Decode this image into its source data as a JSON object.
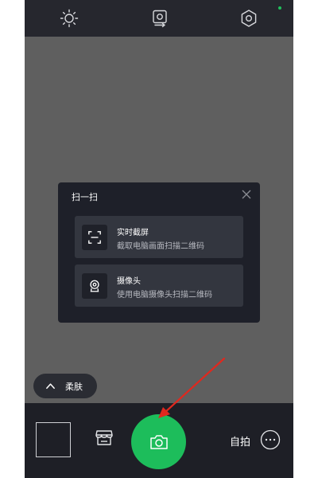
{
  "colors": {
    "topbar_bg": "#26272e",
    "preview_bg": "#5f5f5f",
    "dialog_bg": "#1e2029",
    "option_bg": "#33363f",
    "accent_green": "#1dbd5b",
    "status_dot": "#20c05c",
    "annotation_arrow": "#e0281e"
  },
  "topbar": {
    "icons": [
      "brightness-icon",
      "camera-switch-icon",
      "settings-icon"
    ]
  },
  "scan_dialog": {
    "title": "扫一扫",
    "options": [
      {
        "icon": "screenshot-icon",
        "title": "实时截屏",
        "desc": "截取电脑画面扫描二维码"
      },
      {
        "icon": "webcam-icon",
        "title": "摄像头",
        "desc": "使用电脑摄像头扫描二维码"
      }
    ]
  },
  "beauty": {
    "label": "柔肤",
    "icon": "chevron-up-icon"
  },
  "bottombar": {
    "mall_icon": "store-icon",
    "shutter_icon": "camera-icon",
    "selfie_label": "自拍",
    "more_icon": "more-icon"
  }
}
